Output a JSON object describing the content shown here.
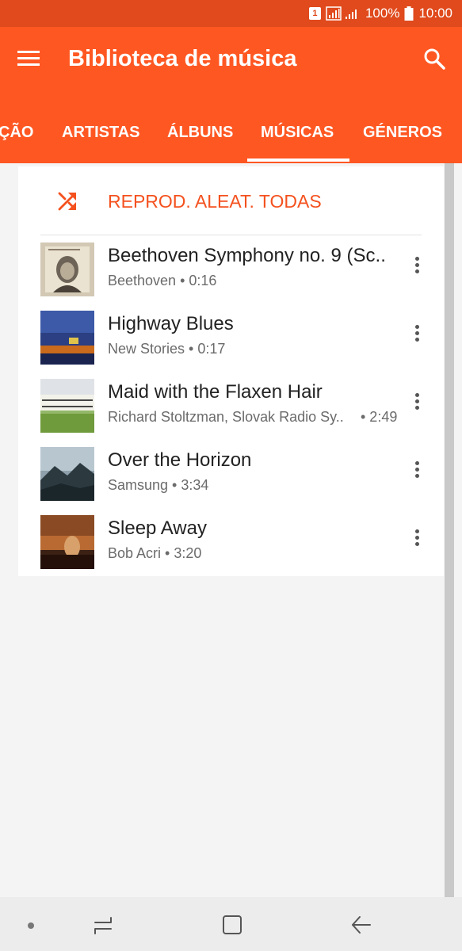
{
  "status_bar": {
    "sim": "1",
    "battery": "100%",
    "time": "10:00",
    "icons": [
      "sim-icon",
      "signal-icon",
      "battery-icon"
    ]
  },
  "app_bar": {
    "title": "Biblioteca de música",
    "icons": [
      "menu-icon",
      "search-icon"
    ]
  },
  "tabs": [
    {
      "label": "ÇÃO",
      "active": false
    },
    {
      "label": "ARTISTAS",
      "active": false
    },
    {
      "label": "ÁLBUNS",
      "active": false
    },
    {
      "label": "MÚSICAS",
      "active": true
    },
    {
      "label": "GÉNEROS",
      "active": false
    }
  ],
  "shuffle": {
    "label": "REPROD. ALEAT. TODAS",
    "icon": "shuffle-icon"
  },
  "songs": [
    {
      "title": "Beethoven Symphony no. 9 (Sc..",
      "meta": "Beethoven • 0:16",
      "duration": ""
    },
    {
      "title": "Highway Blues",
      "meta": "New Stories • 0:17",
      "duration": ""
    },
    {
      "title": "Maid with the Flaxen Hair",
      "meta": "Richard Stoltzman, Slovak Radio Sy..",
      "duration": "• 2:49"
    },
    {
      "title": "Over the Horizon",
      "meta": "Samsung • 3:34",
      "duration": ""
    },
    {
      "title": "Sleep Away",
      "meta": "Bob Acri • 3:20",
      "duration": ""
    }
  ],
  "album_art_text": {
    "art1": "Ludwig Van Beethoven",
    "art3": "RICHARD STOLTZMAN"
  },
  "nav_bar": {
    "icons": [
      "recents-icon",
      "home-icon",
      "back-icon"
    ]
  },
  "colors": {
    "primary": "#ff5722",
    "status_bar": "#e04a1c",
    "accent": "#f4511e",
    "background": "#f4f4f4"
  }
}
